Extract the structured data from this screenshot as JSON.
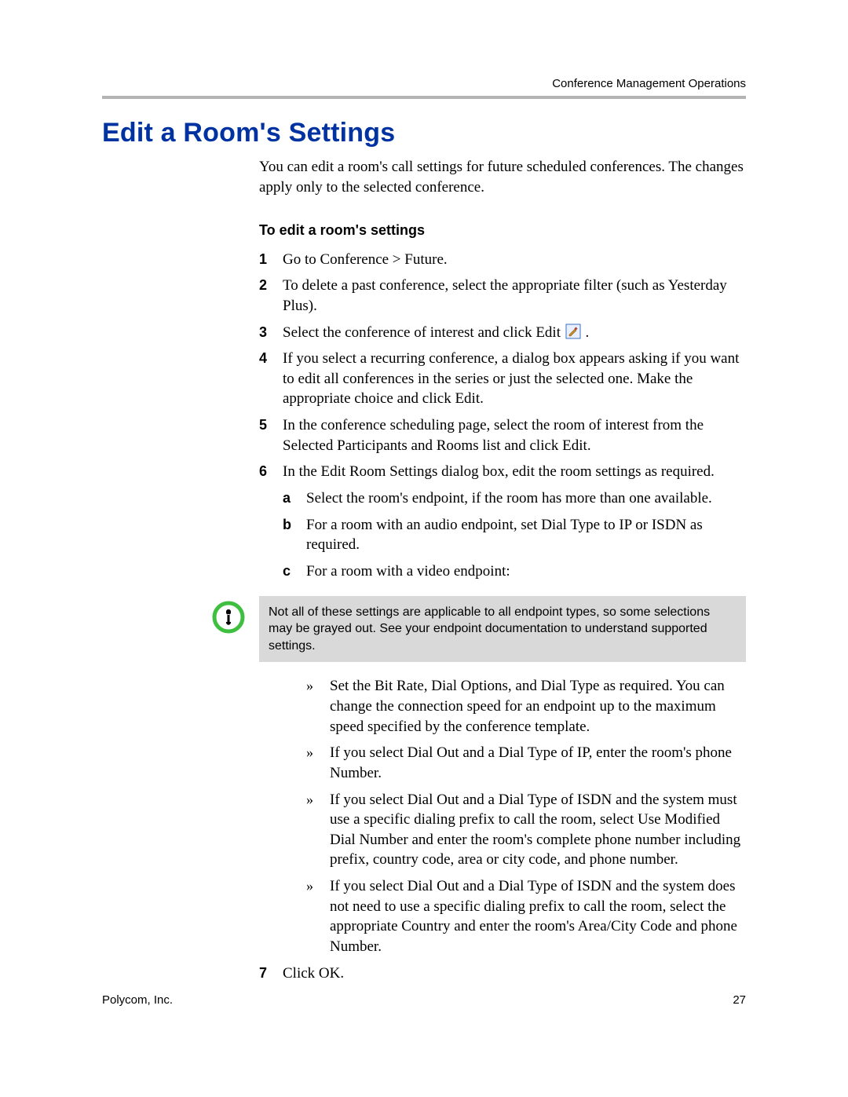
{
  "header": {
    "running_head": "Conference Management Operations"
  },
  "title": "Edit a Room's Settings",
  "intro": "You can edit a room's call settings for future scheduled conferences. The changes apply only to the selected conference.",
  "procedure": {
    "heading": "To edit a room's settings",
    "steps": [
      {
        "n": "1",
        "text": "Go to Conference > Future."
      },
      {
        "n": "2",
        "text": "To delete a past conference, select the appropriate filter (such as Yesterday Plus)."
      },
      {
        "n": "3",
        "text_before": "Select the conference of interest and click Edit ",
        "icon_name": "edit-icon",
        "text_after": "."
      },
      {
        "n": "4",
        "text": "If you select a recurring conference, a dialog box appears asking if you want to edit all conferences in the series or just the selected one. Make the appropriate choice and click Edit."
      },
      {
        "n": "5",
        "text": "In the conference scheduling page, select the room of interest from the Selected Participants and Rooms list and click Edit."
      },
      {
        "n": "6",
        "text": "In the Edit Room Settings dialog box, edit the room settings as required."
      }
    ],
    "substeps_6": [
      {
        "m": "a",
        "text": "Select the room's endpoint, if the room has more than one available."
      },
      {
        "m": "b",
        "text": "For a room with an audio endpoint, set Dial Type to IP or ISDN as required."
      },
      {
        "m": "c",
        "text": "For a room with a video endpoint:"
      }
    ],
    "note": "Not all of these settings are applicable to all endpoint types, so some selections may be grayed out. See your endpoint documentation to understand supported settings.",
    "video_bullets": [
      "Set the Bit Rate, Dial Options, and Dial Type as required. You can change the connection speed for an endpoint up to the maximum speed specified by the conference template.",
      "If you select Dial Out and a Dial Type of IP, enter the room's phone Number.",
      "If you select Dial Out and a Dial Type of ISDN and the system must use a specific dialing prefix to call the room, select Use Modified Dial Number and enter the room's complete phone number including prefix, country code, area or city code, and phone number.",
      "If you select Dial Out and a Dial Type of ISDN and the system does not need to use a specific dialing prefix to call the room, select the appropriate Country and enter the room's Area/City Code and phone Number."
    ],
    "step7": {
      "n": "7",
      "text": "Click OK."
    }
  },
  "footer": {
    "left": "Polycom, Inc.",
    "page_number": "27"
  },
  "colors": {
    "title": "#0033a1",
    "rule": "#b4b4b4",
    "note_bg": "#d9d9d9",
    "note_ring": "#3fbf3f"
  }
}
